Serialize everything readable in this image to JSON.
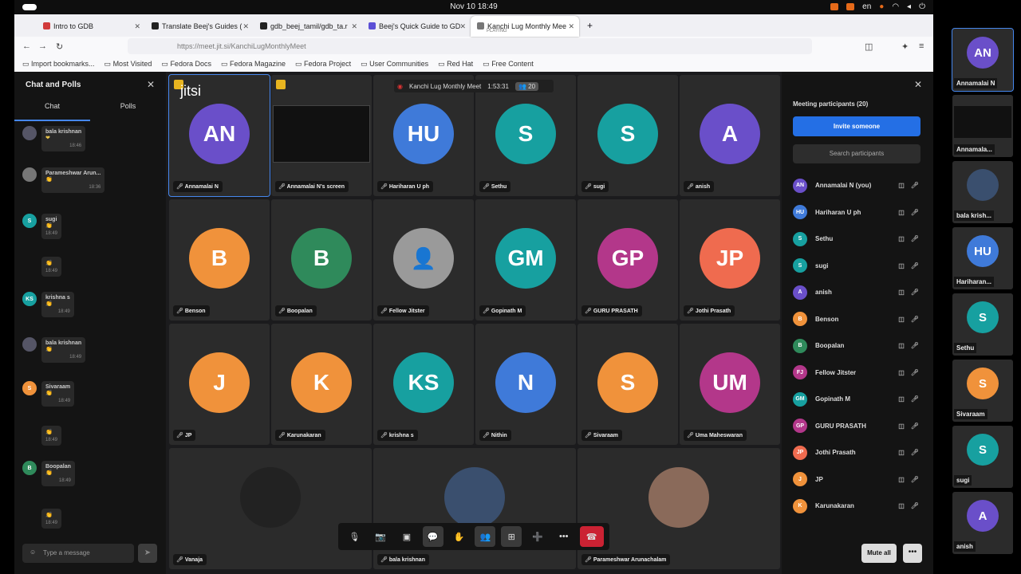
{
  "system": {
    "clock": "Nov 10  18:49",
    "lang": "en"
  },
  "browser": {
    "tabs": [
      {
        "label": "Intro to GDB",
        "color": "#d13b3b"
      },
      {
        "label": "Translate Beej's Guides (",
        "color": "#222"
      },
      {
        "label": "gdb_beej_tamil/gdb_ta.r",
        "color": "#222"
      },
      {
        "label": "Beej's Quick Guide to GD",
        "color": "#5b4fd6"
      },
      {
        "label": "Kanchi Lug Monthly Mee",
        "color": "#777",
        "sub": "PLAYING"
      }
    ],
    "url": "https://meet.jit.si/KanchiLugMonthlyMeet",
    "bookmarks": [
      "Import bookmarks...",
      "Most Visited",
      "Fedora Docs",
      "Fedora Magazine",
      "Fedora Project",
      "User Communities",
      "Red Hat",
      "Free Content"
    ]
  },
  "chat": {
    "title": "Chat and Polls",
    "tab_chat": "Chat",
    "tab_polls": "Polls",
    "placeholder": "Type a message",
    "messages": [
      {
        "name": "bala krishnan",
        "text": "❤",
        "time": "18:46",
        "av": "",
        "color": "#556"
      },
      {
        "name": "Parameshwar Arun...",
        "text": "👏",
        "time": "18:36",
        "av": "",
        "color": "#777"
      },
      {
        "name": "sugi",
        "text": "👏",
        "time": "18:49",
        "av": "S",
        "color": "#17a0a0"
      },
      {
        "name": "",
        "text": "👏",
        "time": "18:49",
        "av": "",
        "color": ""
      },
      {
        "name": "krishna s",
        "text": "👏",
        "time": "18:49",
        "av": "KS",
        "color": "#17a0a0"
      },
      {
        "name": "bala krishnan",
        "text": "👏",
        "time": "18:49",
        "av": "",
        "color": "#556"
      },
      {
        "name": "Sivaraam",
        "text": "👏",
        "time": "18:49",
        "av": "S",
        "color": "#f0923b"
      },
      {
        "name": "",
        "text": "👏",
        "time": "18:49",
        "av": "",
        "color": ""
      },
      {
        "name": "Boopalan",
        "text": "👏",
        "time": "18:49",
        "av": "B",
        "color": "#2f8a5b"
      },
      {
        "name": "",
        "text": "👏",
        "time": "18:49",
        "av": "",
        "color": ""
      }
    ]
  },
  "meeting": {
    "name": "Kanchi Lug Monthly Meet",
    "duration": "1:53:31",
    "count": "20",
    "logo": "jitsi"
  },
  "tiles": [
    {
      "init": "AN",
      "name": "Annamalai N",
      "color": "#6a4fc9"
    },
    {
      "init": "",
      "name": "Annamalai N's screen",
      "color": ""
    },
    {
      "init": "HU",
      "name": "Hariharan U ph",
      "color": "#3f7ad9"
    },
    {
      "init": "S",
      "name": "Sethu",
      "color": "#17a0a0"
    },
    {
      "init": "S",
      "name": "sugi",
      "color": "#17a0a0"
    },
    {
      "init": "A",
      "name": "anish",
      "color": "#6a4fc9"
    },
    {
      "init": "B",
      "name": "Benson",
      "color": "#f0923b"
    },
    {
      "init": "B",
      "name": "Boopalan",
      "color": "#2f8a5b"
    },
    {
      "init": "",
      "name": "Fellow Jitster",
      "color": "#9a9a9a"
    },
    {
      "init": "GM",
      "name": "Gopinath M",
      "color": "#17a0a0"
    },
    {
      "init": "GP",
      "name": "GURU PRASATH",
      "color": "#b3378a"
    },
    {
      "init": "JP",
      "name": "Jothi Prasath",
      "color": "#ef6b4f"
    },
    {
      "init": "J",
      "name": "JP",
      "color": "#f0923b"
    },
    {
      "init": "K",
      "name": "Karunakaran",
      "color": "#f0923b"
    },
    {
      "init": "KS",
      "name": "krishna s",
      "color": "#17a0a0"
    },
    {
      "init": "N",
      "name": "Nithin",
      "color": "#3f7ad9"
    },
    {
      "init": "S",
      "name": "Sivaraam",
      "color": "#f0923b"
    },
    {
      "init": "UM",
      "name": "Uma Maheswaran",
      "color": "#b3378a"
    },
    {
      "init": "",
      "name": "Vanaja",
      "color": "#222"
    },
    {
      "init": "",
      "name": "bala krishnan",
      "color": "#3a4f6e"
    },
    {
      "init": "",
      "name": "Parameshwar Arunachalam",
      "color": "#8a6a5a"
    }
  ],
  "participants": {
    "title": "Meeting participants (20)",
    "invite": "Invite someone",
    "search": "Search participants",
    "mute_all": "Mute all",
    "list": [
      {
        "init": "AN",
        "name": "Annamalai N (you)",
        "color": "#6a4fc9"
      },
      {
        "init": "HU",
        "name": "Hariharan U ph",
        "color": "#3f7ad9"
      },
      {
        "init": "S",
        "name": "Sethu",
        "color": "#17a0a0"
      },
      {
        "init": "S",
        "name": "sugi",
        "color": "#17a0a0"
      },
      {
        "init": "A",
        "name": "anish",
        "color": "#6a4fc9"
      },
      {
        "init": "B",
        "name": "Benson",
        "color": "#f0923b"
      },
      {
        "init": "B",
        "name": "Boopalan",
        "color": "#2f8a5b"
      },
      {
        "init": "FJ",
        "name": "Fellow Jitster",
        "color": "#b3378a"
      },
      {
        "init": "GM",
        "name": "Gopinath M",
        "color": "#17a0a0"
      },
      {
        "init": "GP",
        "name": "GURU PRASATH",
        "color": "#b3378a"
      },
      {
        "init": "JP",
        "name": "Jothi Prasath",
        "color": "#ef6b4f"
      },
      {
        "init": "J",
        "name": "JP",
        "color": "#f0923b"
      },
      {
        "init": "K",
        "name": "Karunakaran",
        "color": "#f0923b"
      }
    ]
  },
  "strip": [
    {
      "init": "AN",
      "name": "Annamalai N",
      "color": "#6a4fc9"
    },
    {
      "init": "",
      "name": "Annamala...",
      "color": ""
    },
    {
      "init": "",
      "name": "bala krish...",
      "color": "#3a4f6e"
    },
    {
      "init": "HU",
      "name": "Hariharan...",
      "color": "#3f7ad9"
    },
    {
      "init": "S",
      "name": "Sethu",
      "color": "#17a0a0"
    },
    {
      "init": "S",
      "name": "Sivaraam",
      "color": "#f0923b"
    },
    {
      "init": "S",
      "name": "sugi",
      "color": "#17a0a0"
    },
    {
      "init": "A",
      "name": "anish",
      "color": "#6a4fc9"
    }
  ]
}
